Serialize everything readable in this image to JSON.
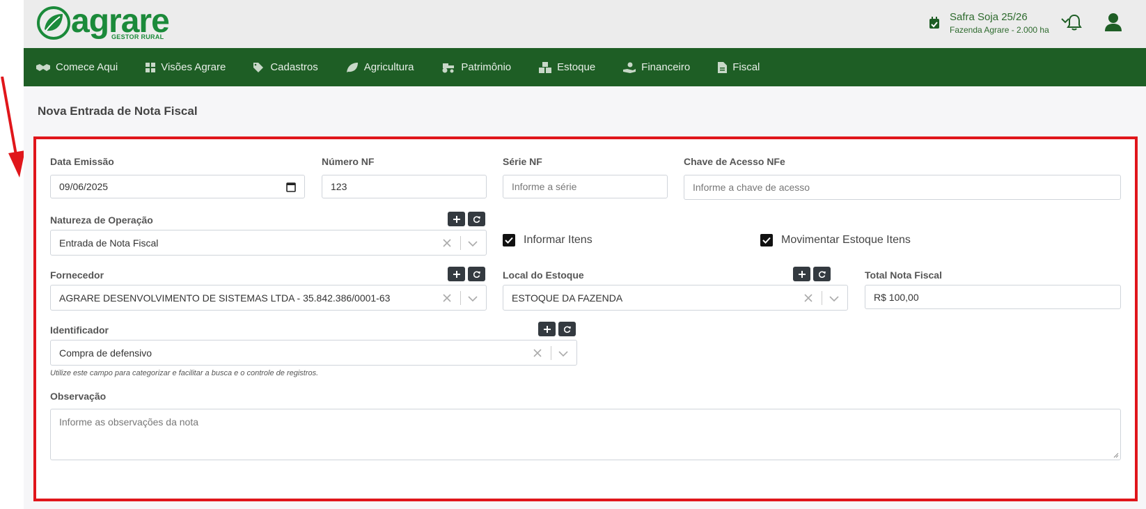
{
  "brand": {
    "name": "agrare",
    "tagline": "GESTOR RURAL",
    "color": "#1b8a3a"
  },
  "header": {
    "safra_title": "Safra Soja 25/26",
    "safra_sub": "Fazenda Agrare - 2.000 ha"
  },
  "nav": [
    {
      "label": "Comece Aqui",
      "icon": "handshake-icon"
    },
    {
      "label": "Visões Agrare",
      "icon": "grid-icon"
    },
    {
      "label": "Cadastros",
      "icon": "tags-icon"
    },
    {
      "label": "Agricultura",
      "icon": "leaf-icon"
    },
    {
      "label": "Patrimônio",
      "icon": "tractor-icon"
    },
    {
      "label": "Estoque",
      "icon": "boxes-icon"
    },
    {
      "label": "Financeiro",
      "icon": "hand-money-icon"
    },
    {
      "label": "Fiscal",
      "icon": "file-invoice-icon"
    }
  ],
  "page": {
    "title": "Nova Entrada de Nota Fiscal"
  },
  "form": {
    "data_emissao": {
      "label": "Data Emissão",
      "value": "09/06/2025"
    },
    "numero_nf": {
      "label": "Número NF",
      "value": "123"
    },
    "serie_nf": {
      "label": "Série NF",
      "placeholder": "Informe a série"
    },
    "chave_acesso": {
      "label": "Chave de Acesso NFe",
      "placeholder": "Informe a chave de acesso"
    },
    "natureza": {
      "label": "Natureza de Operação",
      "value": "Entrada de Nota Fiscal"
    },
    "informar_itens": {
      "label": "Informar Itens",
      "checked": true
    },
    "movimentar_estoque": {
      "label": "Movimentar Estoque Itens",
      "checked": true
    },
    "fornecedor": {
      "label": "Fornecedor",
      "value": "AGRARE DESENVOLVIMENTO DE SISTEMAS LTDA - 35.842.386/0001-63"
    },
    "local_estoque": {
      "label": "Local do Estoque",
      "value": "ESTOQUE DA FAZENDA"
    },
    "total_nf": {
      "label": "Total Nota Fiscal",
      "value": "R$ 100,00"
    },
    "identificador": {
      "label": "Identificador",
      "value": "Compra de defensivo",
      "hint": "Utilize este campo para categorizar e facilitar a busca e o controle de registros."
    },
    "observacao": {
      "label": "Observação",
      "placeholder": "Informe as observações da nota"
    }
  },
  "colors": {
    "nav_bg": "#1e5e25",
    "highlight": "#e0161b",
    "button_dark": "#343a40"
  }
}
